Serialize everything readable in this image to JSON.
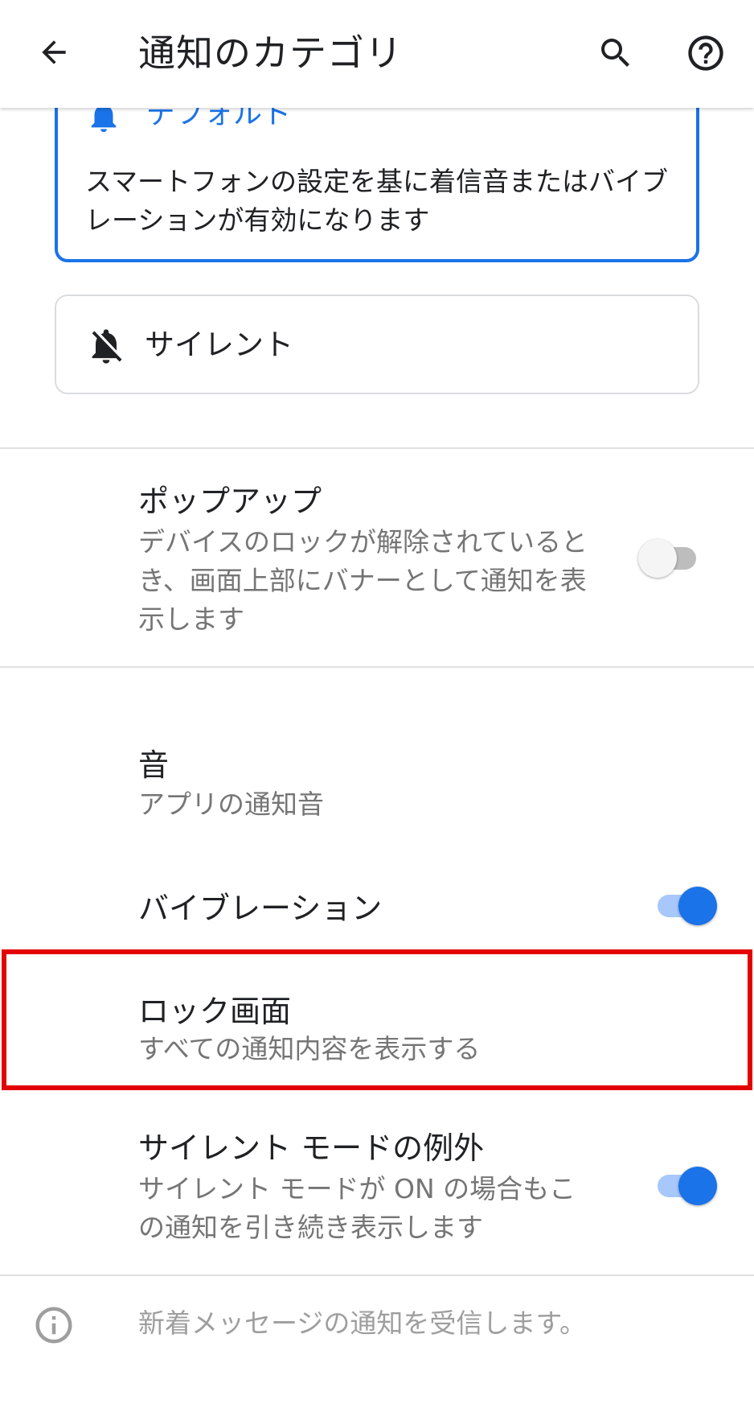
{
  "app_bar": {
    "title": "通知のカテゴリ",
    "back_icon": "arrow-back-icon",
    "search_icon": "search-icon",
    "help_icon": "help-circle-icon"
  },
  "behavior_options": {
    "default": {
      "label": "デフォルト",
      "description": "スマートフォンの設定を基に着信音またはバイブレーションが有効になります",
      "selected": true,
      "icon": "bell-ring-icon"
    },
    "silent": {
      "label": "サイレント",
      "selected": false,
      "icon": "bell-off-icon"
    }
  },
  "settings": {
    "popup": {
      "title": "ポップアップ",
      "summary": "デバイスのロックが解除されているとき、画面上部にバナーとして通知を表示します",
      "enabled": false
    },
    "sound": {
      "title": "音",
      "summary": "アプリの通知音"
    },
    "vibration": {
      "title": "バイブレーション",
      "enabled": true
    },
    "lock_screen": {
      "title": "ロック画面",
      "summary": "すべての通知内容を表示する"
    },
    "dnd_override": {
      "title": "サイレント モードの例外",
      "summary": "サイレント モードが ON の場合もこの通知を引き続き表示します",
      "enabled": true
    }
  },
  "footer": {
    "info_icon": "info-icon",
    "text": "新着メッセージの通知を受信します。"
  },
  "colors": {
    "accent": "#1a73e8",
    "highlight_border": "#e30000"
  }
}
